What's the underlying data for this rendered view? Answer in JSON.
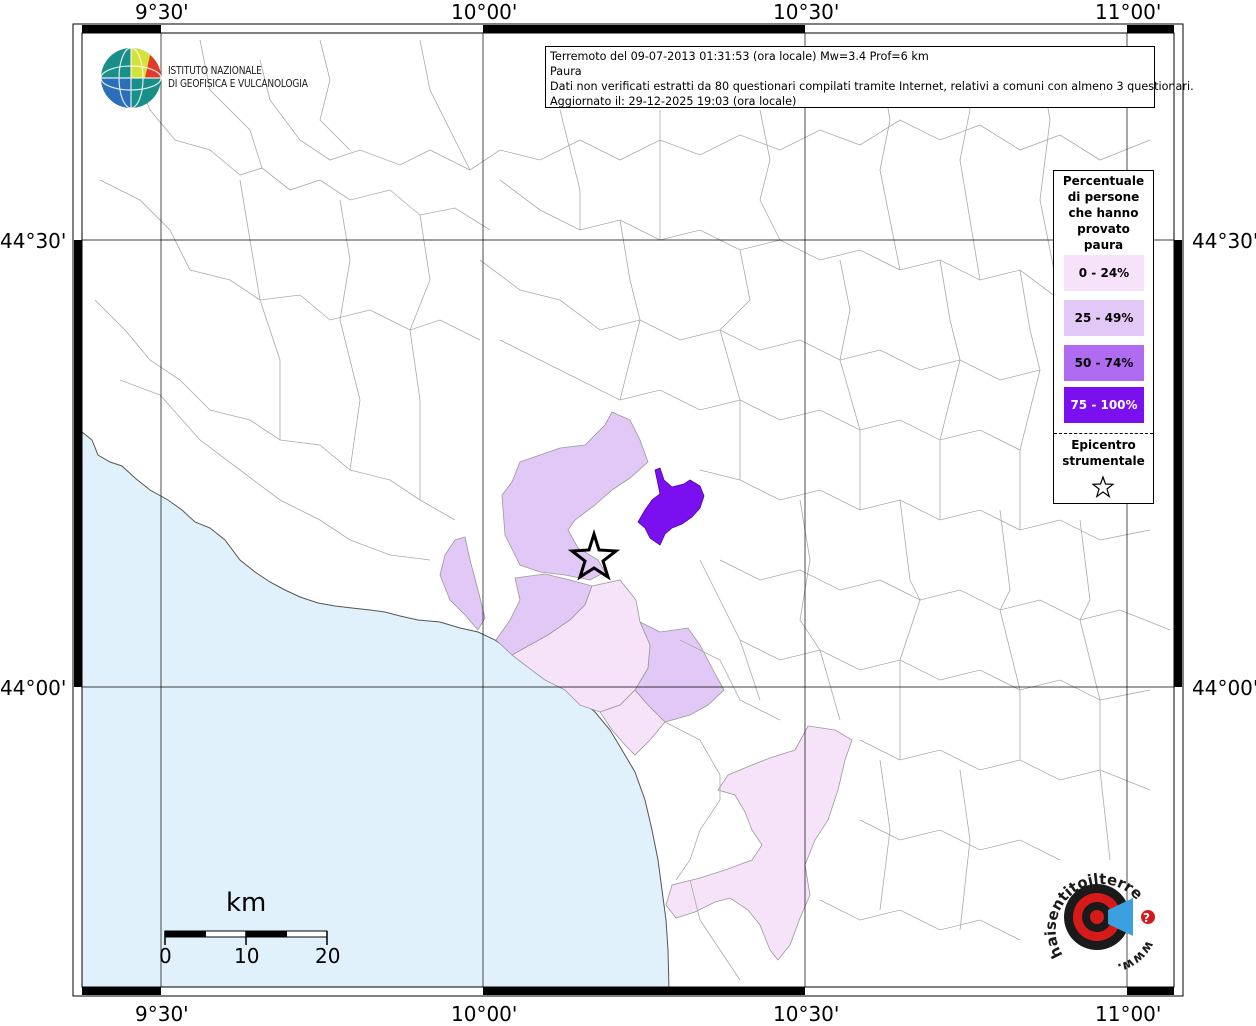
{
  "info": {
    "line1": "Terremoto del 09-07-2013 01:31:53 (ora locale) Mw=3.4 Prof=6 km",
    "line2": "Paura",
    "line3": "Dati non verificati estratti da 80 questionari compilati tramite Internet, relativi a comuni con almeno 3 questionari.",
    "line4": "Aggiornato il: 29-12-2025 19:03 (ora locale)"
  },
  "logo": {
    "line1": "ISTITUTO NAZIONALE",
    "line2": "DI GEOFISICA E VULCANOLOGIA"
  },
  "axes": {
    "top_labels": [
      "9°30'",
      "10°00'",
      "10°30'",
      "11°00'"
    ],
    "bottom_labels": [
      "9°30'",
      "10°00'",
      "10°30'",
      "11°00'"
    ],
    "left_labels": [
      "44°30'",
      "44°00'"
    ],
    "right_labels": [
      "44°30'",
      "44°00'"
    ]
  },
  "legend": {
    "title": "Percentuale di persone che hanno provato paura",
    "classes": [
      {
        "label": "0 - 24%",
        "color": "#f7e3f9"
      },
      {
        "label": "25 - 49%",
        "color": "#e1c8f6"
      },
      {
        "label": "50 - 74%",
        "color": "#b06cf0"
      },
      {
        "label": "75 - 100%",
        "color": "#7a10f0"
      }
    ],
    "epicenter_label": "Epicentro strumentale"
  },
  "scale": {
    "unit": "km",
    "ticks": [
      "0",
      "10",
      "20"
    ]
  },
  "colors": {
    "sea": "#e0f1fc",
    "land": "#ffffff",
    "border": "#999999",
    "frame": "#000000"
  },
  "badge": {
    "text": "haisentitoilterremoto.it",
    "prefix": "www.",
    "question": "?"
  }
}
